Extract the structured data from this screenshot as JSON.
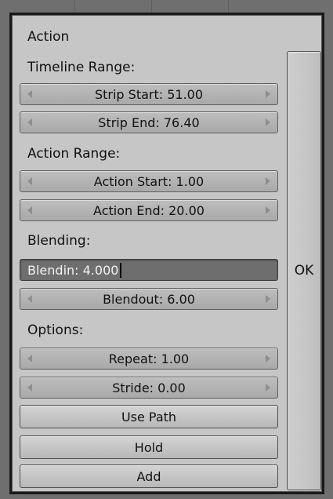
{
  "panel": {
    "title": "Action",
    "sections": {
      "timeline_range": "Timeline Range:",
      "action_range": "Action Range:",
      "blending": "Blending:",
      "options": "Options:"
    },
    "fields": {
      "strip_start": "Strip Start: 51.00",
      "strip_end": "Strip End: 76.40",
      "action_start": "Action Start: 1.00",
      "action_end": "Action End: 20.00",
      "blendin": "Blendin: 4.000",
      "blendout": "Blendout: 6.00",
      "repeat": "Repeat: 1.00",
      "stride": "Stride: 0.00"
    },
    "buttons": {
      "use_path": "Use Path",
      "hold": "Hold",
      "add": "Add",
      "ok": "OK"
    }
  },
  "colors": {
    "panel_bg": "#c6c6c6",
    "active_field_bg": "#6e6e6e",
    "active_field_text": "#f2f2f2"
  }
}
